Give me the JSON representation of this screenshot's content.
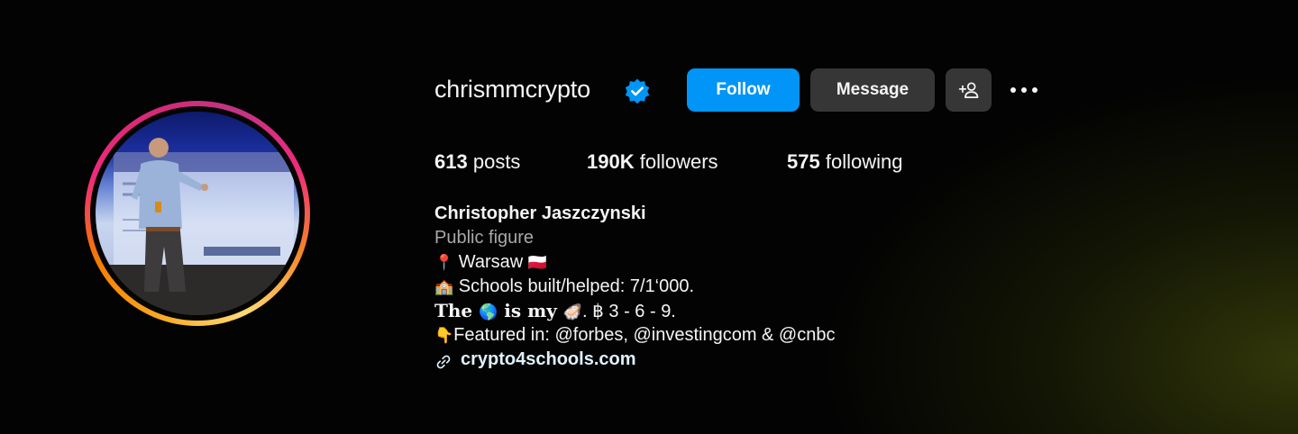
{
  "profile": {
    "username": "chrismmcrypto",
    "verified": true,
    "full_name": "Christopher Jaszczynski",
    "category": "Public figure"
  },
  "actions": {
    "follow_label": "Follow",
    "message_label": "Message"
  },
  "stats": {
    "posts_count": "613",
    "posts_label": "posts",
    "followers_count": "190K",
    "followers_label": "followers",
    "following_count": "575",
    "following_label": "following"
  },
  "bio": {
    "line1_emoji": "📍",
    "line1_text": " Warsaw ",
    "line1_flag": "🇵🇱",
    "line2_emoji": "🏫",
    "line2_text": " Schools built/helped: 7/1‘000.",
    "line3_a": "The ",
    "line3_globe": "🌎",
    "line3_b": " is my ",
    "line3_oyster": "🦪",
    "line3_c": ". ฿ 3 - 6 - 9.",
    "line4_emoji": "👇",
    "line4_text": "Featured in: @forbes, @investingcom & @cnbc",
    "link_text": "crypto4schools.com"
  },
  "colors": {
    "primary_button": "#0095f6",
    "secondary_button": "#363636",
    "verified_badge": "#0095f6",
    "muted_text": "#a8a8a8",
    "link_text": "#e0f1ff"
  },
  "icons": {
    "verified": "verified-badge-icon",
    "add_user": "add-user-icon",
    "more": "more-options-icon",
    "link": "link-icon"
  }
}
